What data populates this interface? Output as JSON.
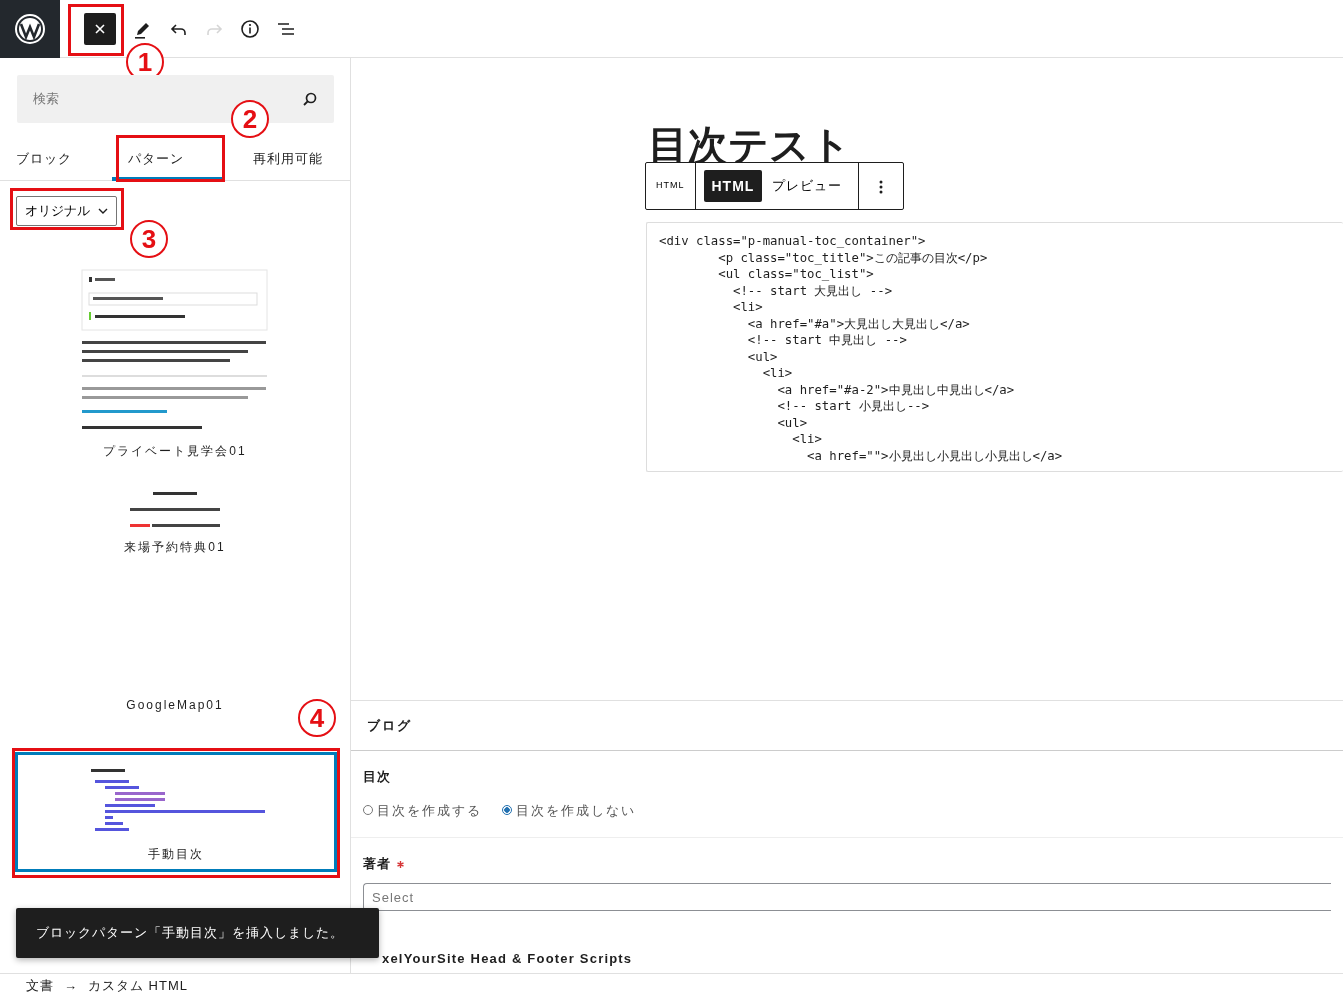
{
  "toolbar": {
    "tools": [
      {
        "kind": "close",
        "disabled": false,
        "highlighted": true,
        "annotation": "1"
      },
      {
        "kind": "edit",
        "disabled": false
      },
      {
        "kind": "undo",
        "disabled": false
      },
      {
        "kind": "redo",
        "disabled": true
      },
      {
        "kind": "info",
        "disabled": false
      },
      {
        "kind": "list",
        "disabled": false
      }
    ]
  },
  "inserter": {
    "search": {
      "placeholder": "検索"
    },
    "tabs": [
      {
        "label": "ブロック",
        "selected": false
      },
      {
        "label": "パターン",
        "selected": true,
        "highlighted": true,
        "annotation": "2"
      },
      {
        "label": "再利用可能",
        "selected": false
      }
    ],
    "category": {
      "value": "オリジナル",
      "highlighted": true,
      "annotation": "3"
    },
    "patterns": [
      {
        "kind": "page",
        "title": "プライベート見学会01",
        "highlighted": false
      },
      {
        "kind": "notice",
        "title": "来場予約特典01",
        "highlighted": false
      },
      {
        "kind": "map",
        "title": "GoogleMap01",
        "highlighted": false
      },
      {
        "kind": "toc",
        "title": "手動目次",
        "highlighted": true,
        "annotation": "4"
      }
    ]
  },
  "editor": {
    "title": "目次テスト",
    "block_toolbar": {
      "block_label": "HTML",
      "tabs": [
        {
          "label": "HTML",
          "selected": true
        },
        {
          "label": "プレビュー",
          "selected": false
        }
      ]
    },
    "code_lines": [
      "<div class=\"p-manual-toc_container\">",
      "        <p class=\"toc_title\">この記事の目次</p>",
      "        <ul class=\"toc_list\">",
      "          <!-- start 大見出し -->",
      "          <li>",
      "            <a href=\"#a\">大見出し大見出し</a>",
      "            <!-- start 中見出し -->",
      "            <ul>",
      "              <li>",
      "                <a href=\"#a-2\">中見出し中見出し</a>",
      "                <!-- start 小見出し-->",
      "                <ul>",
      "                  <li>",
      "                    <a href=\"\">小見出し小見出し小見出し</a>"
    ]
  },
  "meta_boxes": {
    "heading": "ブログ",
    "toc": {
      "label": "目次",
      "options": [
        {
          "label": "目次を作成する",
          "selected": false
        },
        {
          "label": "目次を作成しない",
          "selected": true
        }
      ]
    },
    "author": {
      "label": "著者",
      "required": true,
      "placeholder": "Select"
    },
    "plugin_title": "xelYourSite Head & Footer Scripts"
  },
  "snackbar": "ブロックパターン「手動目次」を挿入しました。",
  "breadcrumb": [
    {
      "label": "文書"
    },
    {
      "label": "→"
    },
    {
      "label": "カスタム HTML"
    }
  ]
}
